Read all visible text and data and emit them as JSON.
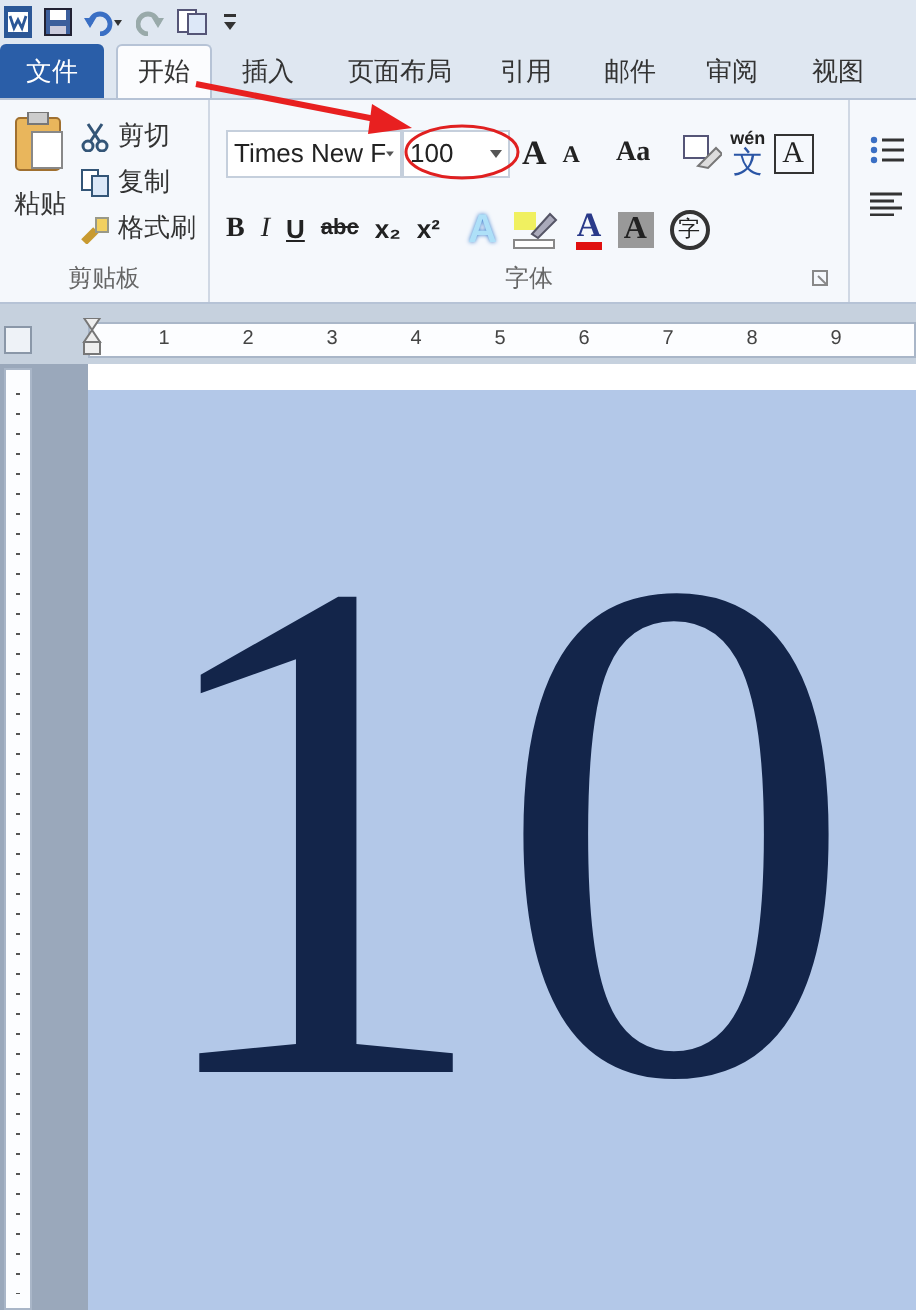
{
  "tabs": [
    {
      "label": "文件",
      "kind": "file",
      "selected": false
    },
    {
      "label": "开始",
      "kind": "tab",
      "selected": true
    },
    {
      "label": "插入",
      "kind": "tab",
      "selected": false
    },
    {
      "label": "页面布局",
      "kind": "tab",
      "selected": false
    },
    {
      "label": "引用",
      "kind": "tab",
      "selected": false
    },
    {
      "label": "邮件",
      "kind": "tab",
      "selected": false
    },
    {
      "label": "审阅",
      "kind": "tab",
      "selected": false
    },
    {
      "label": "视图",
      "kind": "tab",
      "selected": false
    }
  ],
  "clipboard": {
    "paste": "粘贴",
    "cut": "剪切",
    "copy": "复制",
    "format_painter": "格式刷",
    "label": "剪贴板"
  },
  "font": {
    "name": "Times New F",
    "size": "100",
    "label": "字体",
    "row1": [
      "A",
      "A",
      "Aa"
    ],
    "row2": [
      "B",
      "I",
      "U",
      "abc",
      "x₂",
      "x²"
    ],
    "phonetic": "wén",
    "phonetic_char": "文",
    "border_char": "A",
    "shading_char": "A",
    "enclose_char": "字",
    "effect_char": "A",
    "color_char": "A"
  },
  "ruler": {
    "numbers": [
      "1",
      "2",
      "3",
      "4",
      "5",
      "6",
      "7",
      "8",
      "9"
    ]
  },
  "document": {
    "text": "10",
    "highlighted": true
  }
}
